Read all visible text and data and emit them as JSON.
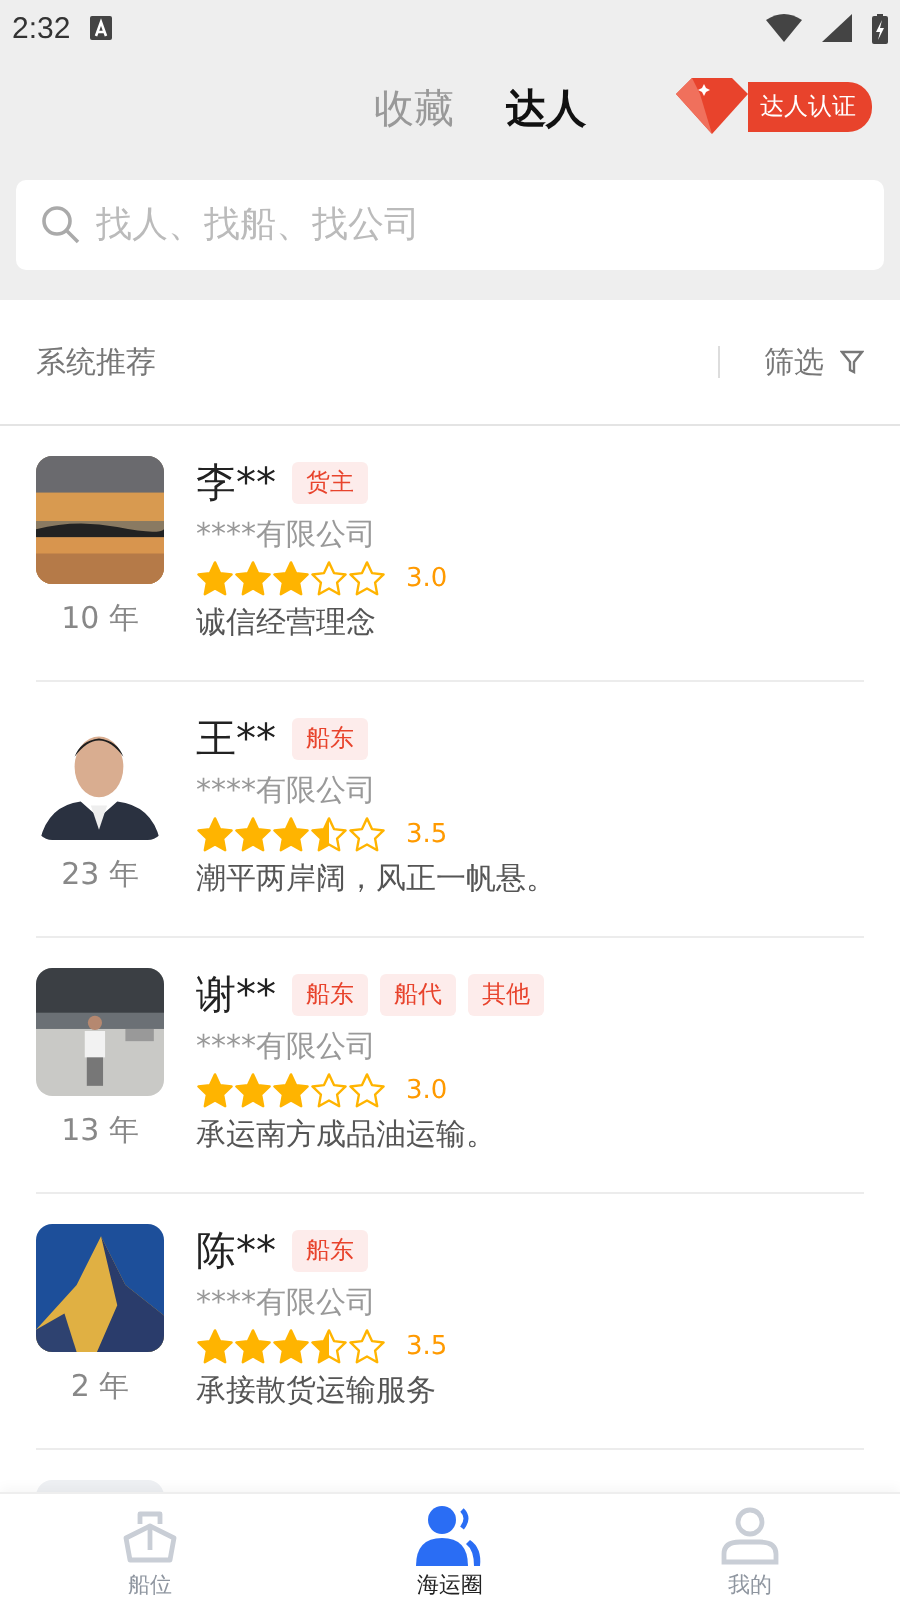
{
  "status_bar": {
    "time": "2:32"
  },
  "header": {
    "tabs": [
      {
        "label": "收藏",
        "selected": false
      },
      {
        "label": "达人",
        "selected": true
      }
    ],
    "badge": "达人认证"
  },
  "search": {
    "placeholder": "找人、找船、找公司"
  },
  "section": {
    "title": "系统推荐",
    "filter": "筛选"
  },
  "people": [
    {
      "name": "李**",
      "tags": [
        "货主"
      ],
      "company": "****有限公司",
      "stars": 3,
      "rating": "3.0",
      "years": "10 年",
      "motto": "诚信经营理念"
    },
    {
      "name": "王**",
      "tags": [
        "船东"
      ],
      "company": "****有限公司",
      "stars": 3.5,
      "rating": "3.5",
      "years": "23 年",
      "motto": "潮平两岸阔，风正一帆悬。"
    },
    {
      "name": "谢**",
      "tags": [
        "船东",
        "船代",
        "其他"
      ],
      "company": "****有限公司",
      "stars": 3,
      "rating": "3.0",
      "years": "13 年",
      "motto": "承运南方成品油运输。"
    },
    {
      "name": "陈**",
      "tags": [
        "船东"
      ],
      "company": "****有限公司",
      "stars": 3.5,
      "rating": "3.5",
      "years": "2 年",
      "motto": "承接散货运输服务"
    },
    {
      "kind": "picture"
    }
  ],
  "nav": [
    {
      "label": "船位",
      "selected": false
    },
    {
      "label": "海运圈",
      "selected": true
    },
    {
      "label": "我的",
      "selected": false
    }
  ]
}
